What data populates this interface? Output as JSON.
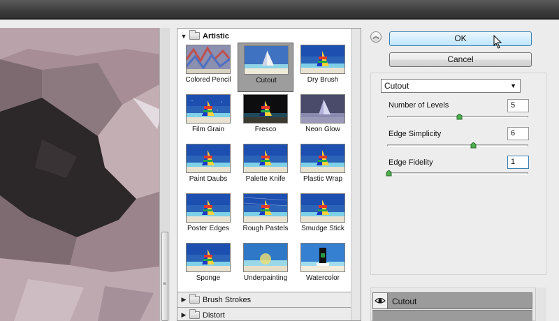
{
  "buttons": {
    "ok": "OK",
    "cancel": "Cancel"
  },
  "gallery": {
    "open_category": "Artistic",
    "filters": [
      {
        "label": "Colored Pencil",
        "scene": "pencil"
      },
      {
        "label": "Cutout",
        "scene": "cutout",
        "selected": true
      },
      {
        "label": "Dry Brush",
        "scene": "boat"
      },
      {
        "label": "Film Grain",
        "scene": "grain"
      },
      {
        "label": "Fresco",
        "scene": "fresco"
      },
      {
        "label": "Neon Glow",
        "scene": "neon"
      },
      {
        "label": "Paint Daubs",
        "scene": "boat"
      },
      {
        "label": "Palette Knife",
        "scene": "boat"
      },
      {
        "label": "Plastic Wrap",
        "scene": "boat"
      },
      {
        "label": "Poster Edges",
        "scene": "boat"
      },
      {
        "label": "Rough Pastels",
        "scene": "rough"
      },
      {
        "label": "Smudge Stick",
        "scene": "boat"
      },
      {
        "label": "Sponge",
        "scene": "boat"
      },
      {
        "label": "Underpainting",
        "scene": "blur"
      },
      {
        "label": "Watercolor",
        "scene": "water"
      }
    ],
    "collapsed_categories": [
      "Brush Strokes",
      "Distort"
    ]
  },
  "settings": {
    "selected_filter": "Cutout",
    "params": [
      {
        "label": "Number of Levels",
        "value": "5",
        "fraction": 0.5
      },
      {
        "label": "Edge Simplicity",
        "value": "6",
        "fraction": 0.6
      },
      {
        "label": "Edge Fidelity",
        "value": "1",
        "fraction": 0.0
      }
    ]
  },
  "effect_layers": [
    {
      "label": "Cutout",
      "visible": true
    }
  ],
  "icons": {
    "collapse": "double-chevron-up-icon",
    "expand_open": "triangle-down-icon",
    "expand_closed": "triangle-right-icon",
    "folder": "folder-icon",
    "visibility": "eye-icon",
    "dropdown": "dropdown-arrow-icon"
  },
  "colors": {
    "ok_border": "#3c7fb1",
    "selected_thumb": "#9d9d9d",
    "preview_tone": "#a98f97"
  }
}
